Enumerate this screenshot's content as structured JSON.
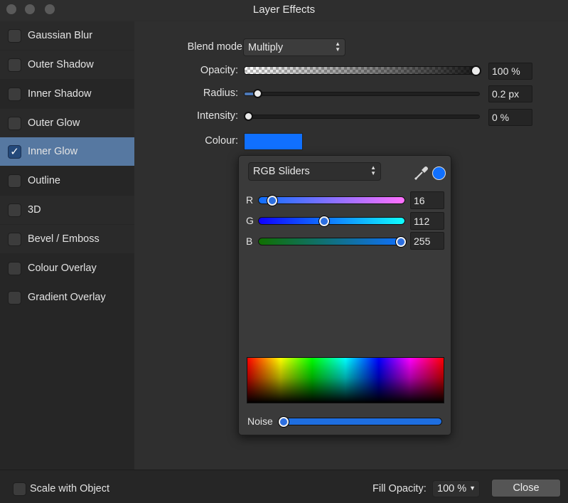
{
  "window": {
    "title": "Layer Effects"
  },
  "sidebar": {
    "items": [
      {
        "label": "Gaussian Blur",
        "checked": false
      },
      {
        "label": "Outer Shadow",
        "checked": false
      },
      {
        "label": "Inner Shadow",
        "checked": false
      },
      {
        "label": "Outer Glow",
        "checked": false
      },
      {
        "label": "Inner Glow",
        "checked": true,
        "check": "✓"
      },
      {
        "label": "Outline",
        "checked": false
      },
      {
        "label": "3D",
        "checked": false
      },
      {
        "label": "Bevel / Emboss",
        "checked": false
      },
      {
        "label": "Colour Overlay",
        "checked": false
      },
      {
        "label": "Gradient Overlay",
        "checked": false
      }
    ],
    "selected_index": 4
  },
  "effect": {
    "blend_mode_label": "Blend mode:",
    "blend_mode_value": "Multiply",
    "opacity_label": "Opacity:",
    "opacity_value": "100 %",
    "opacity_fraction": 1.0,
    "radius_label": "Radius:",
    "radius_value": "0.2 px",
    "radius_fraction": 0.04,
    "intensity_label": "Intensity:",
    "intensity_value": "0 %",
    "intensity_fraction": 0.0,
    "colour_label": "Colour:",
    "colour_hex": "#1070ff"
  },
  "colour_picker": {
    "mode": "RGB Sliders",
    "icons": {
      "eyedropper": "eyedropper-icon",
      "swatch": "colour-swatch-icon"
    },
    "channels": [
      {
        "label": "R",
        "value": "16",
        "fraction": 0.063
      },
      {
        "label": "G",
        "value": "112",
        "fraction": 0.439
      },
      {
        "label": "B",
        "value": "255",
        "fraction": 1.0
      }
    ],
    "noise_label": "Noise",
    "noise_fraction": 0.0
  },
  "footer": {
    "scale_label": "Scale with Object",
    "scale_checked": false,
    "fill_opacity_label": "Fill Opacity:",
    "fill_opacity_value": "100 %",
    "close_label": "Close"
  },
  "colors": {
    "accent_selected": "#5678a1",
    "traffic_light_inactive": "#5a5a5a"
  }
}
